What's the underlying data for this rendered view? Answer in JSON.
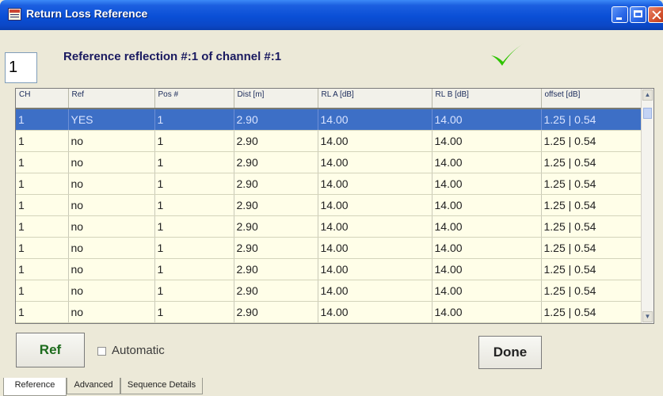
{
  "window": {
    "title": "Return Loss Reference"
  },
  "header": {
    "ref_number": "1",
    "heading": "Reference reflection #:1 of channel #:1",
    "status_icon": "checkmark-icon",
    "status_color": "#2fc400"
  },
  "table": {
    "columns": [
      "CH",
      "Ref",
      "Pos #",
      "Dist [m]",
      "RL A [dB]",
      "RL B [dB]",
      "offset [dB]"
    ],
    "rows": [
      [
        "1",
        "YES",
        "1",
        "2.90",
        "14.00",
        "14.00",
        "1.25 | 0.54"
      ],
      [
        "1",
        "no",
        "1",
        "2.90",
        "14.00",
        "14.00",
        "1.25 | 0.54"
      ],
      [
        "1",
        "no",
        "1",
        "2.90",
        "14.00",
        "14.00",
        "1.25 | 0.54"
      ],
      [
        "1",
        "no",
        "1",
        "2.90",
        "14.00",
        "14.00",
        "1.25 | 0.54"
      ],
      [
        "1",
        "no",
        "1",
        "2.90",
        "14.00",
        "14.00",
        "1.25 | 0.54"
      ],
      [
        "1",
        "no",
        "1",
        "2.90",
        "14.00",
        "14.00",
        "1.25 | 0.54"
      ],
      [
        "1",
        "no",
        "1",
        "2.90",
        "14.00",
        "14.00",
        "1.25 | 0.54"
      ],
      [
        "1",
        "no",
        "1",
        "2.90",
        "14.00",
        "14.00",
        "1.25 | 0.54"
      ],
      [
        "1",
        "no",
        "1",
        "2.90",
        "14.00",
        "14.00",
        "1.25 | 0.54"
      ],
      [
        "1",
        "no",
        "1",
        "2.90",
        "14.00",
        "14.00",
        "1.25 | 0.54"
      ]
    ],
    "selected_row": 0
  },
  "controls": {
    "ref_label": "Ref",
    "automatic_label": "Automatic",
    "automatic_checked": false,
    "done_label": "Done"
  },
  "tabs": [
    {
      "label": "Reference",
      "active": true
    },
    {
      "label": "Advanced",
      "active": false
    },
    {
      "label": "Sequence Details",
      "active": false
    }
  ]
}
